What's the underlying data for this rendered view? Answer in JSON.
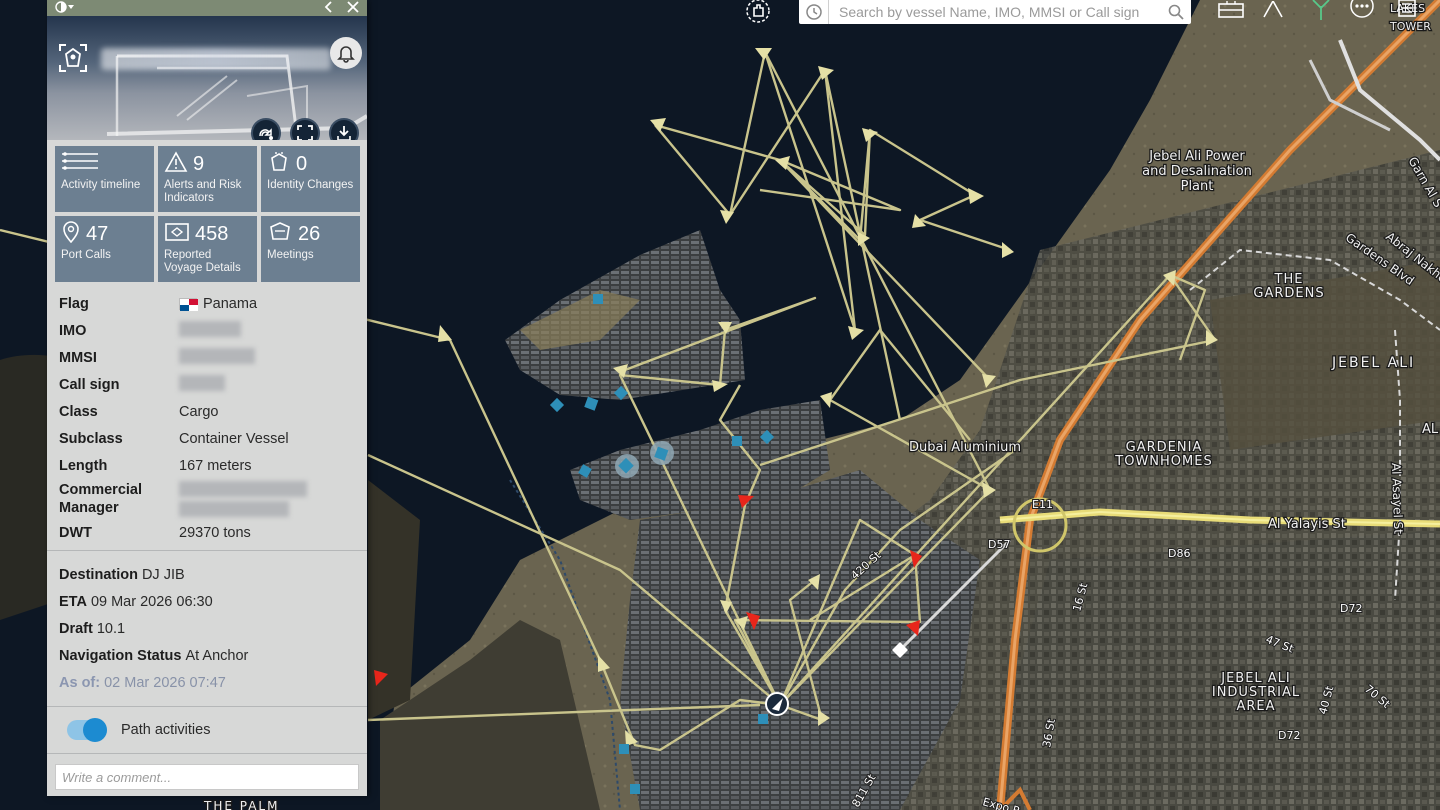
{
  "map": {
    "labels": {
      "power_plant": [
        "Jebel Ali Power",
        "and Desalination",
        "Plant"
      ],
      "gardens": [
        "THE",
        "GARDENS"
      ],
      "gardens_blvd": "Gardens Blvd",
      "jebel_ali": "JEBEL ALI",
      "gardenia": [
        "GARDENIA",
        "TOWNHOMES"
      ],
      "dubai_aluminium": "Dubai Aluminium",
      "industrial": [
        "JEBEL ALI",
        "INDUSTRIAL",
        "AREA"
      ],
      "al_yalayis": "Al Yalayis St",
      "al_asayel": "Al Asayel St",
      "abraj": "Abraj Nakhe",
      "garn_alsabkha": "Garn Al S",
      "st420": "420 St",
      "st16": "16 St",
      "st47": "47 St",
      "st40": "40 St",
      "st70": "70 St",
      "st36": "36 St",
      "st811": "811 St",
      "expo": "Expo R",
      "the_palm": "THE PALM",
      "lakes_tower": [
        "LAKES",
        "TOWER"
      ],
      "e11": "E11",
      "d57": "D57",
      "d86": "D86",
      "d72a": "D72",
      "d72b": "D72",
      "al": "AL"
    }
  },
  "search": {
    "placeholder": "Search by vessel Name, IMO, MMSI or Call sign"
  },
  "topbar": {
    "icons": [
      "vessel-pointer-icon",
      "briefcase-icon",
      "alert-triangle-icon",
      "antenna-icon",
      "more-icon",
      "list-icon"
    ]
  },
  "panel": {
    "tiles": [
      {
        "id": "activity",
        "icon": "timeline-icon",
        "count": "",
        "label": "Activity timeline"
      },
      {
        "id": "alerts",
        "icon": "alert-icon",
        "count": "9",
        "label": "Alerts and Risk Indicators"
      },
      {
        "id": "identity",
        "icon": "identity-icon",
        "count": "0",
        "label": "Identity Changes"
      },
      {
        "id": "ports",
        "icon": "pin-icon",
        "count": "47",
        "label": "Port Calls"
      },
      {
        "id": "voyage",
        "icon": "voyage-icon",
        "count": "458",
        "label": "Reported Voyage Details"
      },
      {
        "id": "meetings",
        "icon": "meetings-icon",
        "count": "26",
        "label": "Meetings"
      }
    ],
    "details": {
      "flag_label": "Flag",
      "flag_value": "Panama",
      "imo_label": "IMO",
      "mmsi_label": "MMSI",
      "callsign_label": "Call sign",
      "class_label": "Class",
      "class_value": "Cargo",
      "subclass_label": "Subclass",
      "subclass_value": "Container Vessel",
      "length_label": "Length",
      "length_value": "167 meters",
      "manager_label": "Commercial Manager",
      "dwt_label": "DWT",
      "dwt_value": "29370 tons"
    },
    "voyage": {
      "destination_label": "Destination",
      "destination_value": "DJ JIB",
      "eta_label": "ETA",
      "eta_value": "09 Mar 2026 06:30",
      "draft_label": "Draft",
      "draft_value": "10.1",
      "nav_label": "Navigation Status",
      "nav_value": "At Anchor",
      "asof_label": "As of:",
      "asof_value": "02 Mar 2026 07:47"
    },
    "path_activities_label": "Path activities",
    "path_activities_on": true,
    "comment_placeholder": "Write a comment..."
  },
  "colors": {
    "track": "#c9c48c",
    "panel_tile": "#6c7f91",
    "accent_blue": "#1c8bd1",
    "alert_marker": "#e8261b",
    "port_marker": "#2e8fb8"
  }
}
